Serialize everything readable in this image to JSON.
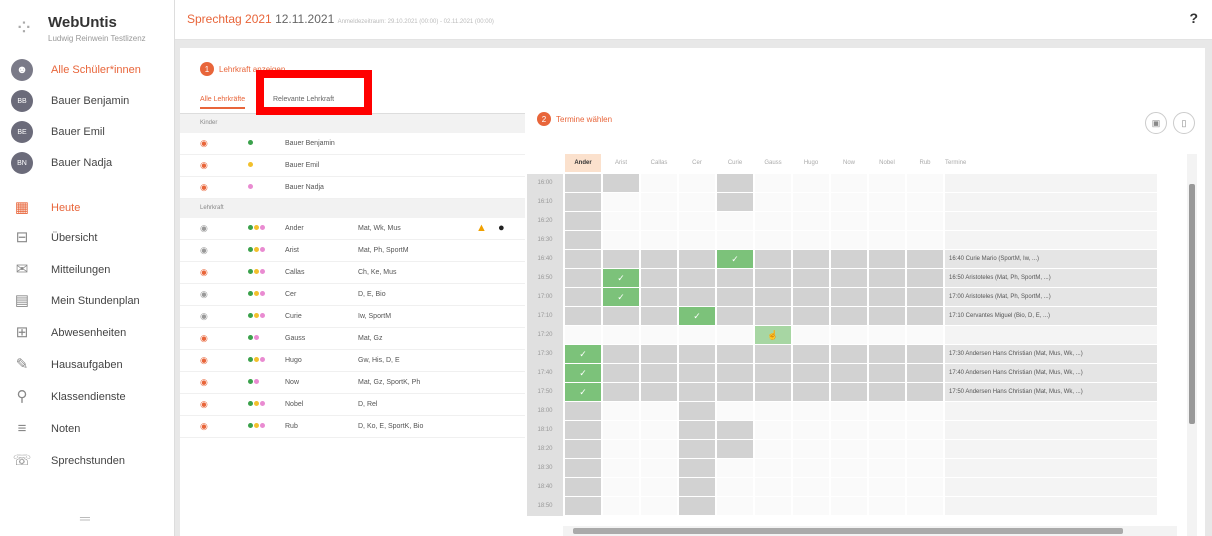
{
  "app": {
    "name": "WebUntis",
    "license": "Ludwig Reinwein Testlizenz"
  },
  "topbar": {
    "title": "Sprechtag 2021",
    "date": "12.11.2021",
    "subtitle": "Anmeldezeitraum: 29.10.2021 (00:00) - 02.11.2021 (00:00)",
    "help": "?"
  },
  "sidebar": {
    "items": [
      {
        "label": "Alle Schüler*innen",
        "avatar": "",
        "icon": "group-icon",
        "active": true
      },
      {
        "label": "Bauer Benjamin",
        "avatar": "BB"
      },
      {
        "label": "Bauer Emil",
        "avatar": "BE"
      },
      {
        "label": "Bauer Nadja",
        "avatar": "BN"
      },
      {
        "label": "Heute",
        "icon": "dashboard-icon",
        "active": true
      },
      {
        "label": "Übersicht",
        "icon": "overview-icon"
      },
      {
        "label": "Mitteilungen",
        "icon": "mail-icon"
      },
      {
        "label": "Mein Stundenplan",
        "icon": "calendar-icon"
      },
      {
        "label": "Abwesenheiten",
        "icon": "absence-icon"
      },
      {
        "label": "Hausaufgaben",
        "icon": "homework-icon"
      },
      {
        "label": "Klassendienste",
        "icon": "class-duties-icon"
      },
      {
        "label": "Noten",
        "icon": "grades-icon"
      },
      {
        "label": "Sprechstunden",
        "icon": "consultation-icon"
      }
    ],
    "collapse": "═"
  },
  "left": {
    "step_num": "1",
    "step_label": "Lehrkraft anzeigen",
    "tab_all": "Alle Lehrkräfte",
    "tab_relevant": "Relevante Lehrkraft",
    "section_kids": "Kinder",
    "section_teachers": "Lehrkraft",
    "kids": [
      {
        "name": "Bauer Benjamin",
        "color": "#3aa14b"
      },
      {
        "name": "Bauer Emil",
        "color": "#f2c02c"
      },
      {
        "name": "Bauer Nadja",
        "color": "#e98bd1"
      }
    ],
    "teachers": [
      {
        "name": "Ander",
        "subjects": "Mat, Wk, Mus",
        "warn": true
      },
      {
        "name": "Arist",
        "subjects": "Mat, Ph, SportM"
      },
      {
        "name": "Callas",
        "subjects": "Ch, Ke, Mus"
      },
      {
        "name": "Cer",
        "subjects": "D, E, Bio"
      },
      {
        "name": "Curie",
        "subjects": "Iw, SportM"
      },
      {
        "name": "Gauss",
        "subjects": "Mat, Gz"
      },
      {
        "name": "Hugo",
        "subjects": "Gw, His, D, E"
      },
      {
        "name": "Now",
        "subjects": "Mat, Gz, SportK, Ph"
      },
      {
        "name": "Nobel",
        "subjects": "D, Rel"
      },
      {
        "name": "Rub",
        "subjects": "D, Ko, E, SportK, Bio"
      }
    ]
  },
  "right": {
    "step_num": "2",
    "step_label": "Termine wählen",
    "columns": [
      "Ander",
      "Arist",
      "Callas",
      "Cer",
      "Curie",
      "Gauss",
      "Hugo",
      "Now",
      "Nobel",
      "Rub",
      "Termine"
    ],
    "times": [
      "16:00",
      "16:10",
      "16:20",
      "16:30",
      "16:40",
      "16:50",
      "17:00",
      "17:10",
      "17:20",
      "17:30",
      "17:40",
      "17:50",
      "18:00",
      "18:10",
      "18:20",
      "18:30",
      "18:40",
      "18:50"
    ],
    "bookings": [
      "",
      "",
      "",
      "",
      "16:40 Curie Mario (SportM, Iw, ...)",
      "16:50 Aristoteles (Mat, Ph, SportM, ...)",
      "17:00 Aristoteles (Mat, Ph, SportM, ...)",
      "17:10 Cervantes Miguel (Bio, D, E, ...)",
      "",
      "17:30 Andersen Hans Christian (Mat, Mus, Wk, ...)",
      "17:40 Andersen Hans Christian (Mat, Mus, Wk, ...)",
      "17:50 Andersen Hans Christian (Mat, Mus, Wk, ...)",
      "",
      "",
      "",
      "",
      "",
      ""
    ]
  }
}
